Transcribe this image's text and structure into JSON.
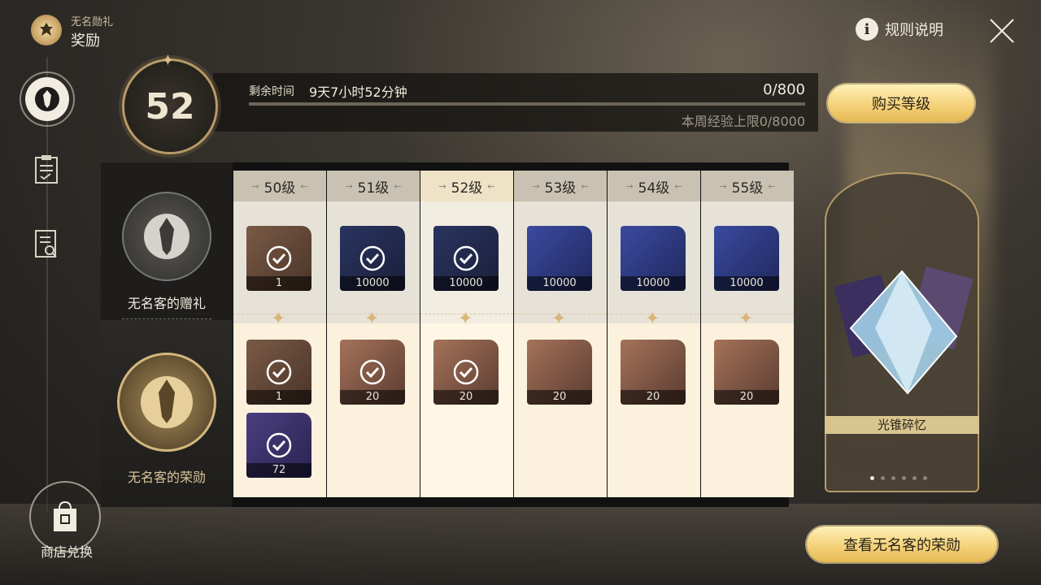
{
  "header": {
    "subtitle": "无名勋礼",
    "title": "奖励"
  },
  "top_right": {
    "rules_label": "规则说明"
  },
  "level": {
    "current": "52",
    "remaining_label": "剩余时间",
    "remaining_value": "9天7小时52分钟",
    "exp": "0/800",
    "exp_progress": 0,
    "weekly_limit": "本周经验上限0/8000",
    "buy_label": "购买等级"
  },
  "tracks": {
    "free_label": "无名客的赠礼",
    "paid_label": "无名客的荣勋"
  },
  "columns": [
    {
      "level": "50级",
      "free": {
        "qty": "1",
        "claimed": true
      },
      "paid": [
        {
          "qty": "1",
          "claimed": true
        },
        {
          "qty": "72",
          "claimed": true
        }
      ]
    },
    {
      "level": "51级",
      "free": {
        "qty": "10000",
        "claimed": true
      },
      "paid": [
        {
          "qty": "20",
          "claimed": true
        }
      ]
    },
    {
      "level": "52级",
      "free": {
        "qty": "10000",
        "claimed": true
      },
      "paid": [
        {
          "qty": "20",
          "claimed": true
        }
      ]
    },
    {
      "level": "53级",
      "free": {
        "qty": "10000",
        "claimed": false
      },
      "paid": [
        {
          "qty": "20",
          "claimed": false
        }
      ]
    },
    {
      "level": "54级",
      "free": {
        "qty": "10000",
        "claimed": false
      },
      "paid": [
        {
          "qty": "20",
          "claimed": false
        }
      ]
    },
    {
      "level": "55级",
      "free": {
        "qty": "10000",
        "claimed": false
      },
      "paid": [
        {
          "qty": "20",
          "claimed": false
        }
      ]
    }
  ],
  "preview": {
    "title": "光锥碎忆",
    "page_count": 6,
    "active_page": 1
  },
  "view_button": "查看无名客的荣勋",
  "shop_label": "商店兑换",
  "colors": {
    "accent_gold": "#e7b955",
    "check_white": "#ffffff"
  }
}
